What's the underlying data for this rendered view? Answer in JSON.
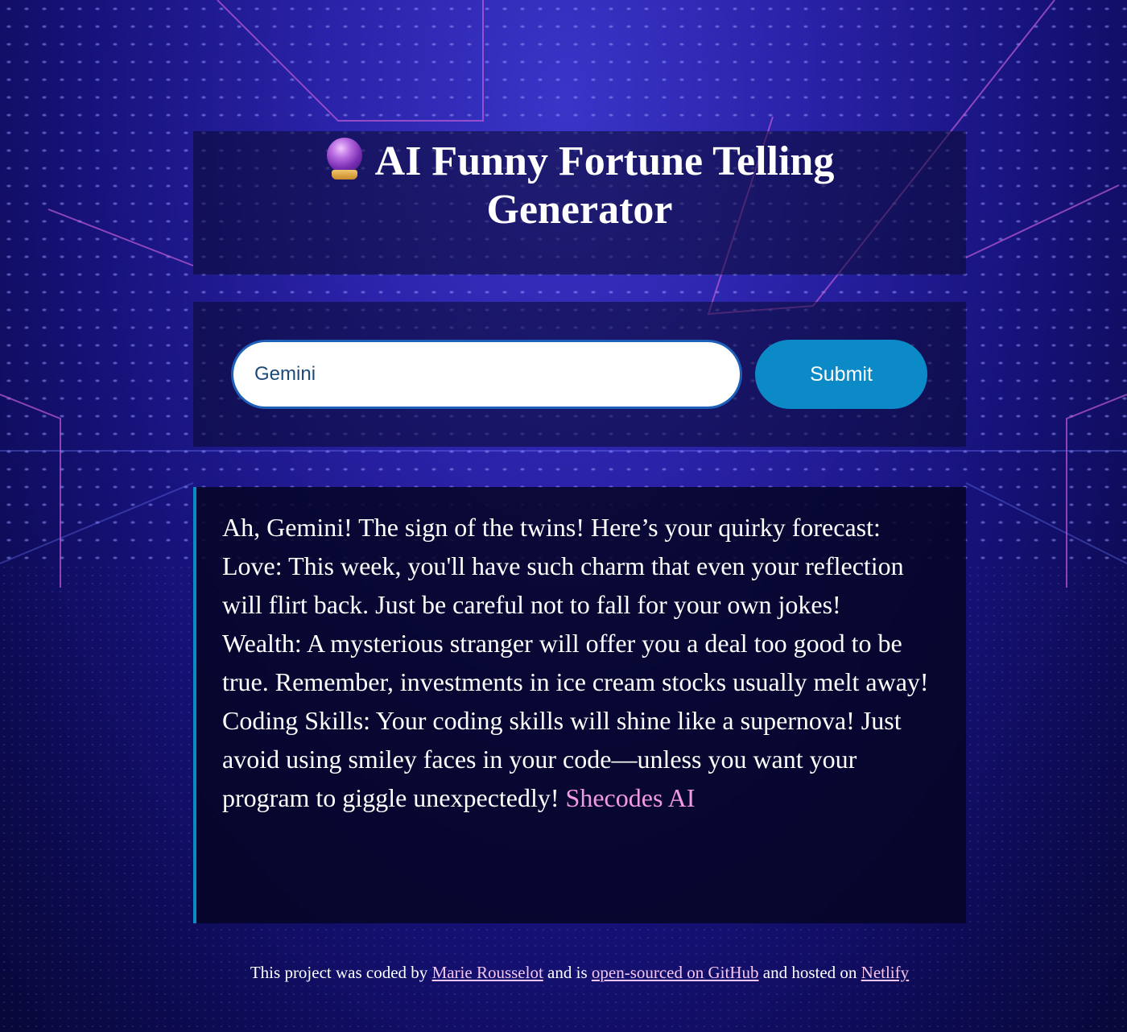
{
  "header": {
    "title": "AI Funny Fortune Telling Generator",
    "title_icon": "crystal-ball-icon"
  },
  "form": {
    "input_value": "Gemini",
    "submit_label": "Submit"
  },
  "answer": {
    "lines": [
      "Ah, Gemini! The sign of the twins! Here’s your quirky forecast:",
      "Love: This week, you'll have such charm that even your reflection will flirt back. Just be careful not to fall for your own jokes!",
      "Wealth: A mysterious stranger will offer you a deal too good to be true. Remember, investments in ice cream stocks usually melt away!",
      "Coding Skills: Your coding skills will shine like a supernova! Just avoid using smiley faces in your code—unless you want your program to giggle unexpectedly!"
    ],
    "signature": "Shecodes AI"
  },
  "footer": {
    "text_1": "This project was coded by",
    "author_link": "Marie Rousselot",
    "text_2": "and is",
    "github_link": "open-sourced on GitHub",
    "text_3": "and hosted on",
    "netlify_link": "Netlify"
  },
  "colors": {
    "accent": "#0b8ac7",
    "signature": "#f39ae4",
    "link": "#f7c6ee"
  }
}
